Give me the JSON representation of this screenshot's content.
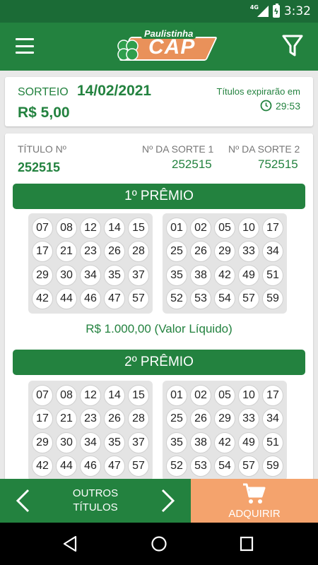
{
  "status_bar": {
    "network": "4G",
    "battery_icon": "battery-charging-icon",
    "time": "3:32"
  },
  "app_bar": {
    "menu_icon": "hamburger-menu-icon",
    "logo_top": "Paulistinha",
    "logo_main": "CAP",
    "filter_icon": "filter-icon"
  },
  "draw": {
    "label": "SORTEIO",
    "date": "14/02/2021",
    "price": "R$ 5,00",
    "expire_label": "Títulos expirarão em",
    "expire_time": "29:53"
  },
  "ticket": {
    "title_label": "TÍTULO Nº",
    "title_value": "252515",
    "luck1_label": "Nº DA SORTE 1",
    "luck1_value": "252515",
    "luck2_label": "Nº DA SORTE 2",
    "luck2_value": "752515"
  },
  "prizes": [
    {
      "label": "1º PRÊMIO",
      "value": "R$ 1.000,00 (Valor Líquido)",
      "grid_left": [
        "07",
        "08",
        "12",
        "14",
        "15",
        "17",
        "21",
        "23",
        "26",
        "28",
        "29",
        "30",
        "34",
        "35",
        "37",
        "42",
        "44",
        "46",
        "47",
        "57"
      ],
      "grid_right": [
        "01",
        "02",
        "05",
        "10",
        "17",
        "25",
        "26",
        "29",
        "33",
        "34",
        "35",
        "38",
        "42",
        "49",
        "51",
        "52",
        "53",
        "54",
        "57",
        "59"
      ]
    },
    {
      "label": "2º PRÊMIO",
      "grid_left": [
        "07",
        "08",
        "12",
        "14",
        "15",
        "17",
        "21",
        "23",
        "26",
        "28",
        "29",
        "30",
        "34",
        "35",
        "37",
        "42",
        "44",
        "46",
        "47",
        "57"
      ],
      "grid_right": [
        "01",
        "02",
        "05",
        "10",
        "17",
        "25",
        "26",
        "29",
        "33",
        "34",
        "35",
        "38",
        "42",
        "49",
        "51",
        "52",
        "53",
        "54",
        "57",
        "59"
      ]
    }
  ],
  "bottom_bar": {
    "others_line1": "OUTROS",
    "others_line2": "TÍTULOS",
    "buy_label": "ADQUIRIR",
    "colors": {
      "green": "#23823f",
      "orange": "#f4a36d"
    }
  }
}
